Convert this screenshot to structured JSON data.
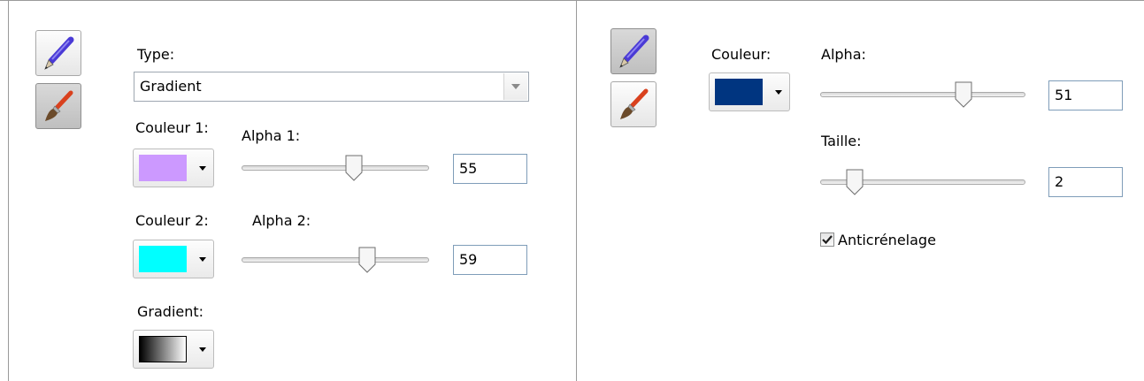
{
  "left_panel": {
    "type_label": "Type:",
    "type_value": "Gradient",
    "color1_label": "Couleur 1:",
    "alpha1_label": "Alpha 1:",
    "color1": "#cc99ff",
    "alpha1_value": "55",
    "alpha1_level": 0.6,
    "color2_label": "Couleur 2:",
    "alpha2_label": "Alpha 2:",
    "color2": "#00ffff",
    "alpha2_value": "59",
    "alpha2_level": 0.67,
    "gradient_label": "Gradient:",
    "pen_tool_icon": "pen-icon",
    "brush_tool_icon": "brush-icon"
  },
  "right_panel": {
    "color_label": "Couleur:",
    "color": "#003580",
    "alpha_label": "Alpha:",
    "alpha_value": "51",
    "alpha_level": 0.7,
    "size_label": "Taille:",
    "size_value": "2",
    "size_level": 0.17,
    "antialias_label": "Anticrénelage",
    "antialias_checked": true,
    "pen_tool_icon": "pen-icon",
    "brush_tool_icon": "brush-icon"
  }
}
